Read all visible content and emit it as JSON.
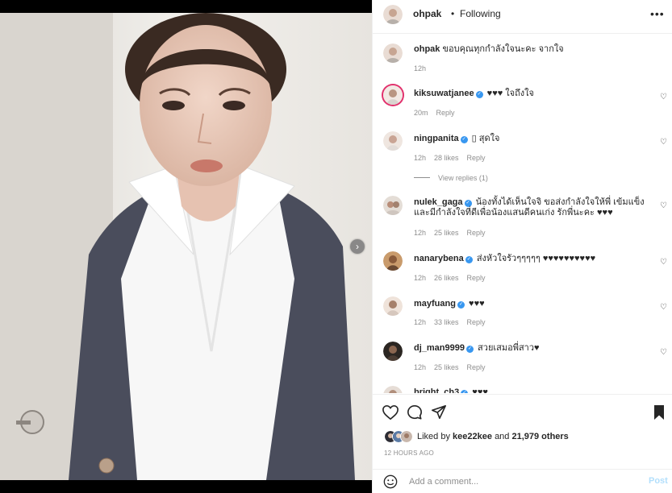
{
  "post": {
    "username": "ohpak",
    "separator": "•",
    "follow_status": "Following",
    "more_icon": "ellipsis-icon",
    "caption": {
      "username": "ohpak",
      "text": "ขอบคุณทุกกำลังใจนะคะ จากใจ",
      "time": "12h"
    },
    "comments": [
      {
        "username": "kiksuwatjanee",
        "verified": true,
        "text": "♥♥♥ ใจถึงใจ",
        "time": "20m",
        "likes": "",
        "reply": "Reply"
      },
      {
        "username": "ningpanita",
        "verified": true,
        "text": "▯ สุดใจ",
        "time": "12h",
        "likes": "28 likes",
        "reply": "Reply",
        "view_replies": "View replies (1)"
      },
      {
        "username": "nulek_gaga",
        "verified": true,
        "text": "น้องทั้งได้เห็นใจจิ ขอส่งกำลังใจให้พี่ เข้มแข็ง และมีกำลังใจที่ดีเพื่อน้องแสนดีคนเก่ง รักพี่นะคะ ♥♥♥",
        "time": "12h",
        "likes": "25 likes",
        "reply": "Reply"
      },
      {
        "username": "nanarybena",
        "verified": true,
        "text": "ส่งหัวใจรัวๆๆๆๆๆ ♥♥♥♥♥♥♥♥♥♥",
        "time": "12h",
        "likes": "26 likes",
        "reply": "Reply"
      },
      {
        "username": "mayfuang",
        "verified": true,
        "text": "♥♥♥",
        "time": "12h",
        "likes": "33 likes",
        "reply": "Reply"
      },
      {
        "username": "dj_man9999",
        "verified": true,
        "text": "สวยเสมอพี่สาว♥",
        "time": "12h",
        "likes": "25 likes",
        "reply": "Reply"
      },
      {
        "username": "bright_ch3",
        "verified": true,
        "text": "♥♥♥",
        "time": "",
        "likes": "",
        "reply": ""
      }
    ],
    "liked_by_prefix": "Liked by",
    "liked_by_user": "kee22kee",
    "liked_by_and": "and",
    "liked_by_count": "21,979 others",
    "timestamp": "12 HOURS AGO",
    "comment_placeholder": "Add a comment...",
    "post_button": "Post",
    "next_icon": "chevron-right-icon"
  },
  "colors": {
    "verified": "#3897f0",
    "post_button": "#b2dffc",
    "muted": "#8e8e8e"
  }
}
